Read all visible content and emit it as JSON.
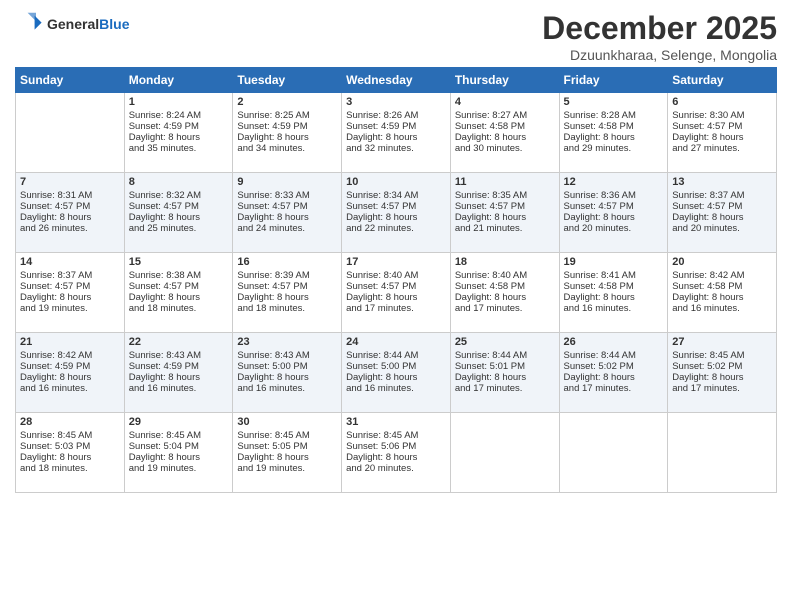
{
  "header": {
    "logo_line1": "General",
    "logo_line2": "Blue",
    "month": "December 2025",
    "location": "Dzuunkharaa, Selenge, Mongolia"
  },
  "weekdays": [
    "Sunday",
    "Monday",
    "Tuesday",
    "Wednesday",
    "Thursday",
    "Friday",
    "Saturday"
  ],
  "weeks": [
    [
      {
        "day": "",
        "sunrise": "",
        "sunset": "",
        "daylight": ""
      },
      {
        "day": "1",
        "sunrise": "Sunrise: 8:24 AM",
        "sunset": "Sunset: 4:59 PM",
        "daylight": "Daylight: 8 hours and 35 minutes."
      },
      {
        "day": "2",
        "sunrise": "Sunrise: 8:25 AM",
        "sunset": "Sunset: 4:59 PM",
        "daylight": "Daylight: 8 hours and 34 minutes."
      },
      {
        "day": "3",
        "sunrise": "Sunrise: 8:26 AM",
        "sunset": "Sunset: 4:59 PM",
        "daylight": "Daylight: 8 hours and 32 minutes."
      },
      {
        "day": "4",
        "sunrise": "Sunrise: 8:27 AM",
        "sunset": "Sunset: 4:58 PM",
        "daylight": "Daylight: 8 hours and 30 minutes."
      },
      {
        "day": "5",
        "sunrise": "Sunrise: 8:28 AM",
        "sunset": "Sunset: 4:58 PM",
        "daylight": "Daylight: 8 hours and 29 minutes."
      },
      {
        "day": "6",
        "sunrise": "Sunrise: 8:30 AM",
        "sunset": "Sunset: 4:57 PM",
        "daylight": "Daylight: 8 hours and 27 minutes."
      }
    ],
    [
      {
        "day": "7",
        "sunrise": "Sunrise: 8:31 AM",
        "sunset": "Sunset: 4:57 PM",
        "daylight": "Daylight: 8 hours and 26 minutes."
      },
      {
        "day": "8",
        "sunrise": "Sunrise: 8:32 AM",
        "sunset": "Sunset: 4:57 PM",
        "daylight": "Daylight: 8 hours and 25 minutes."
      },
      {
        "day": "9",
        "sunrise": "Sunrise: 8:33 AM",
        "sunset": "Sunset: 4:57 PM",
        "daylight": "Daylight: 8 hours and 24 minutes."
      },
      {
        "day": "10",
        "sunrise": "Sunrise: 8:34 AM",
        "sunset": "Sunset: 4:57 PM",
        "daylight": "Daylight: 8 hours and 22 minutes."
      },
      {
        "day": "11",
        "sunrise": "Sunrise: 8:35 AM",
        "sunset": "Sunset: 4:57 PM",
        "daylight": "Daylight: 8 hours and 21 minutes."
      },
      {
        "day": "12",
        "sunrise": "Sunrise: 8:36 AM",
        "sunset": "Sunset: 4:57 PM",
        "daylight": "Daylight: 8 hours and 20 minutes."
      },
      {
        "day": "13",
        "sunrise": "Sunrise: 8:37 AM",
        "sunset": "Sunset: 4:57 PM",
        "daylight": "Daylight: 8 hours and 20 minutes."
      }
    ],
    [
      {
        "day": "14",
        "sunrise": "Sunrise: 8:37 AM",
        "sunset": "Sunset: 4:57 PM",
        "daylight": "Daylight: 8 hours and 19 minutes."
      },
      {
        "day": "15",
        "sunrise": "Sunrise: 8:38 AM",
        "sunset": "Sunset: 4:57 PM",
        "daylight": "Daylight: 8 hours and 18 minutes."
      },
      {
        "day": "16",
        "sunrise": "Sunrise: 8:39 AM",
        "sunset": "Sunset: 4:57 PM",
        "daylight": "Daylight: 8 hours and 18 minutes."
      },
      {
        "day": "17",
        "sunrise": "Sunrise: 8:40 AM",
        "sunset": "Sunset: 4:57 PM",
        "daylight": "Daylight: 8 hours and 17 minutes."
      },
      {
        "day": "18",
        "sunrise": "Sunrise: 8:40 AM",
        "sunset": "Sunset: 4:58 PM",
        "daylight": "Daylight: 8 hours and 17 minutes."
      },
      {
        "day": "19",
        "sunrise": "Sunrise: 8:41 AM",
        "sunset": "Sunset: 4:58 PM",
        "daylight": "Daylight: 8 hours and 16 minutes."
      },
      {
        "day": "20",
        "sunrise": "Sunrise: 8:42 AM",
        "sunset": "Sunset: 4:58 PM",
        "daylight": "Daylight: 8 hours and 16 minutes."
      }
    ],
    [
      {
        "day": "21",
        "sunrise": "Sunrise: 8:42 AM",
        "sunset": "Sunset: 4:59 PM",
        "daylight": "Daylight: 8 hours and 16 minutes."
      },
      {
        "day": "22",
        "sunrise": "Sunrise: 8:43 AM",
        "sunset": "Sunset: 4:59 PM",
        "daylight": "Daylight: 8 hours and 16 minutes."
      },
      {
        "day": "23",
        "sunrise": "Sunrise: 8:43 AM",
        "sunset": "Sunset: 5:00 PM",
        "daylight": "Daylight: 8 hours and 16 minutes."
      },
      {
        "day": "24",
        "sunrise": "Sunrise: 8:44 AM",
        "sunset": "Sunset: 5:00 PM",
        "daylight": "Daylight: 8 hours and 16 minutes."
      },
      {
        "day": "25",
        "sunrise": "Sunrise: 8:44 AM",
        "sunset": "Sunset: 5:01 PM",
        "daylight": "Daylight: 8 hours and 17 minutes."
      },
      {
        "day": "26",
        "sunrise": "Sunrise: 8:44 AM",
        "sunset": "Sunset: 5:02 PM",
        "daylight": "Daylight: 8 hours and 17 minutes."
      },
      {
        "day": "27",
        "sunrise": "Sunrise: 8:45 AM",
        "sunset": "Sunset: 5:02 PM",
        "daylight": "Daylight: 8 hours and 17 minutes."
      }
    ],
    [
      {
        "day": "28",
        "sunrise": "Sunrise: 8:45 AM",
        "sunset": "Sunset: 5:03 PM",
        "daylight": "Daylight: 8 hours and 18 minutes."
      },
      {
        "day": "29",
        "sunrise": "Sunrise: 8:45 AM",
        "sunset": "Sunset: 5:04 PM",
        "daylight": "Daylight: 8 hours and 19 minutes."
      },
      {
        "day": "30",
        "sunrise": "Sunrise: 8:45 AM",
        "sunset": "Sunset: 5:05 PM",
        "daylight": "Daylight: 8 hours and 19 minutes."
      },
      {
        "day": "31",
        "sunrise": "Sunrise: 8:45 AM",
        "sunset": "Sunset: 5:06 PM",
        "daylight": "Daylight: 8 hours and 20 minutes."
      },
      {
        "day": "",
        "sunrise": "",
        "sunset": "",
        "daylight": ""
      },
      {
        "day": "",
        "sunrise": "",
        "sunset": "",
        "daylight": ""
      },
      {
        "day": "",
        "sunrise": "",
        "sunset": "",
        "daylight": ""
      }
    ]
  ]
}
